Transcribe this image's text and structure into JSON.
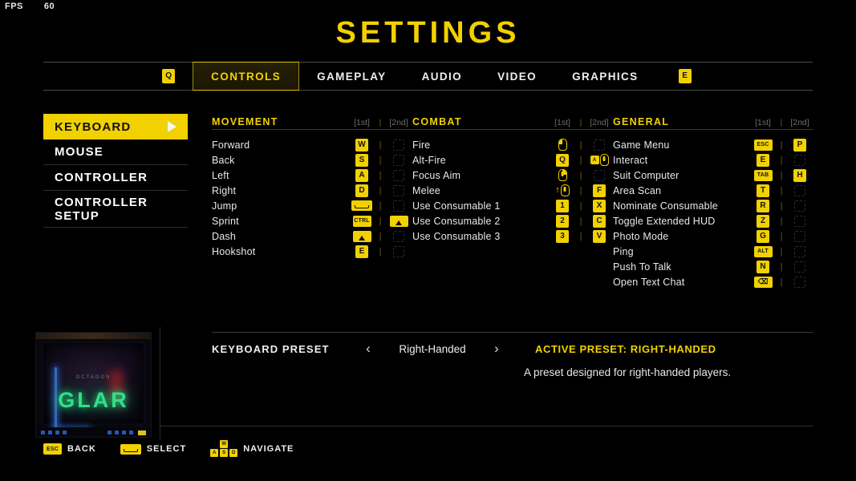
{
  "hud": {
    "fps_label": "FPS",
    "fps_value": "60"
  },
  "header": {
    "title": "SETTINGS"
  },
  "tabs": {
    "prev_key": "Q",
    "next_key": "E",
    "items": [
      {
        "label": "CONTROLS",
        "active": true
      },
      {
        "label": "GAMEPLAY",
        "active": false
      },
      {
        "label": "AUDIO",
        "active": false
      },
      {
        "label": "VIDEO",
        "active": false
      },
      {
        "label": "GRAPHICS",
        "active": false
      }
    ]
  },
  "sidebar": {
    "items": [
      {
        "label": "KEYBOARD",
        "active": true
      },
      {
        "label": "MOUSE",
        "active": false
      },
      {
        "label": "CONTROLLER",
        "active": false
      },
      {
        "label": "CONTROLLER SETUP",
        "active": false
      }
    ]
  },
  "bindings": {
    "slot_headers": {
      "first": "[1st]",
      "second": "[2nd]",
      "separator": "|"
    },
    "columns": [
      {
        "title": "MOVEMENT",
        "rows": [
          {
            "action": "Forward",
            "first": "W",
            "first_type": "key",
            "second": "",
            "second_type": "empty"
          },
          {
            "action": "Back",
            "first": "S",
            "first_type": "key",
            "second": "",
            "second_type": "empty"
          },
          {
            "action": "Left",
            "first": "A",
            "first_type": "key",
            "second": "",
            "second_type": "empty"
          },
          {
            "action": "Right",
            "first": "D",
            "first_type": "key",
            "second": "",
            "second_type": "empty"
          },
          {
            "action": "Jump",
            "first": "SPACE",
            "first_type": "space",
            "second": "",
            "second_type": "empty"
          },
          {
            "action": "Sprint",
            "first": "CTRL",
            "first_type": "wide",
            "second": "SHIFT",
            "second_type": "shift"
          },
          {
            "action": "Dash",
            "first": "SHIFT",
            "first_type": "shift",
            "second": "",
            "second_type": "empty"
          },
          {
            "action": "Hookshot",
            "first": "E",
            "first_type": "key",
            "second": "",
            "second_type": "empty"
          }
        ]
      },
      {
        "title": "COMBAT",
        "rows": [
          {
            "action": "Fire",
            "first": "LMB",
            "first_type": "mouse-left",
            "second": "",
            "second_type": "empty"
          },
          {
            "action": "Alt-Fire",
            "first": "Q",
            "first_type": "key",
            "second": "ALT+MMB",
            "second_type": "alt-mouse"
          },
          {
            "action": "Focus Aim",
            "first": "RMB",
            "first_type": "mouse-right",
            "second": "",
            "second_type": "empty"
          },
          {
            "action": "Melee",
            "first": "SHIFT+MMB",
            "first_type": "shift-mouse",
            "second": "F",
            "second_type": "key"
          },
          {
            "action": "Use Consumable 1",
            "first": "1",
            "first_type": "key",
            "second": "X",
            "second_type": "key"
          },
          {
            "action": "Use Consumable 2",
            "first": "2",
            "first_type": "key",
            "second": "C",
            "second_type": "key"
          },
          {
            "action": "Use Consumable 3",
            "first": "3",
            "first_type": "key",
            "second": "V",
            "second_type": "key"
          }
        ]
      },
      {
        "title": "GENERAL",
        "rows": [
          {
            "action": "Game Menu",
            "first": "ESC",
            "first_type": "wide",
            "second": "P",
            "second_type": "key"
          },
          {
            "action": "Interact",
            "first": "E",
            "first_type": "key",
            "second": "",
            "second_type": "empty"
          },
          {
            "action": "Suit Computer",
            "first": "TAB",
            "first_type": "wide",
            "second": "H",
            "second_type": "key"
          },
          {
            "action": "Area Scan",
            "first": "T",
            "first_type": "key",
            "second": "",
            "second_type": "empty"
          },
          {
            "action": "Nominate Consumable",
            "first": "R",
            "first_type": "key",
            "second": "",
            "second_type": "empty"
          },
          {
            "action": "Toggle Extended HUD",
            "first": "Z",
            "first_type": "key",
            "second": "",
            "second_type": "empty"
          },
          {
            "action": "Photo Mode",
            "first": "G",
            "first_type": "key",
            "second": "",
            "second_type": "empty"
          },
          {
            "action": "Ping",
            "first": "ALT",
            "first_type": "wide",
            "second": "",
            "second_type": "empty"
          },
          {
            "action": "Push To Talk",
            "first": "N",
            "first_type": "key",
            "second": "",
            "second_type": "empty"
          },
          {
            "action": "Open Text Chat",
            "first": "BACKSPACE",
            "first_type": "backspace",
            "second": "",
            "second_type": "empty"
          }
        ]
      }
    ]
  },
  "preset": {
    "label": "KEYBOARD PRESET",
    "prev_arrow": "‹",
    "next_arrow": "›",
    "value": "Right-Handed",
    "active_text": "ACTIVE PRESET: RIGHT-HANDED",
    "description": "A preset designed for right-handed players."
  },
  "preview": {
    "neon_text": "GLAR",
    "neon_sub": "OCTAGON"
  },
  "footer": {
    "hints": [
      {
        "key": "ESC",
        "label": "BACK"
      },
      {
        "key": "SPACE",
        "label": "SELECT"
      },
      {
        "key": "WASD",
        "label": "NAVIGATE"
      }
    ],
    "wasd": {
      "up": "W",
      "left": "A",
      "down": "S",
      "right": "D"
    }
  },
  "colors": {
    "accent": "#f2d100",
    "background": "#000000",
    "text": "#efefef",
    "muted": "#6d6d64"
  }
}
